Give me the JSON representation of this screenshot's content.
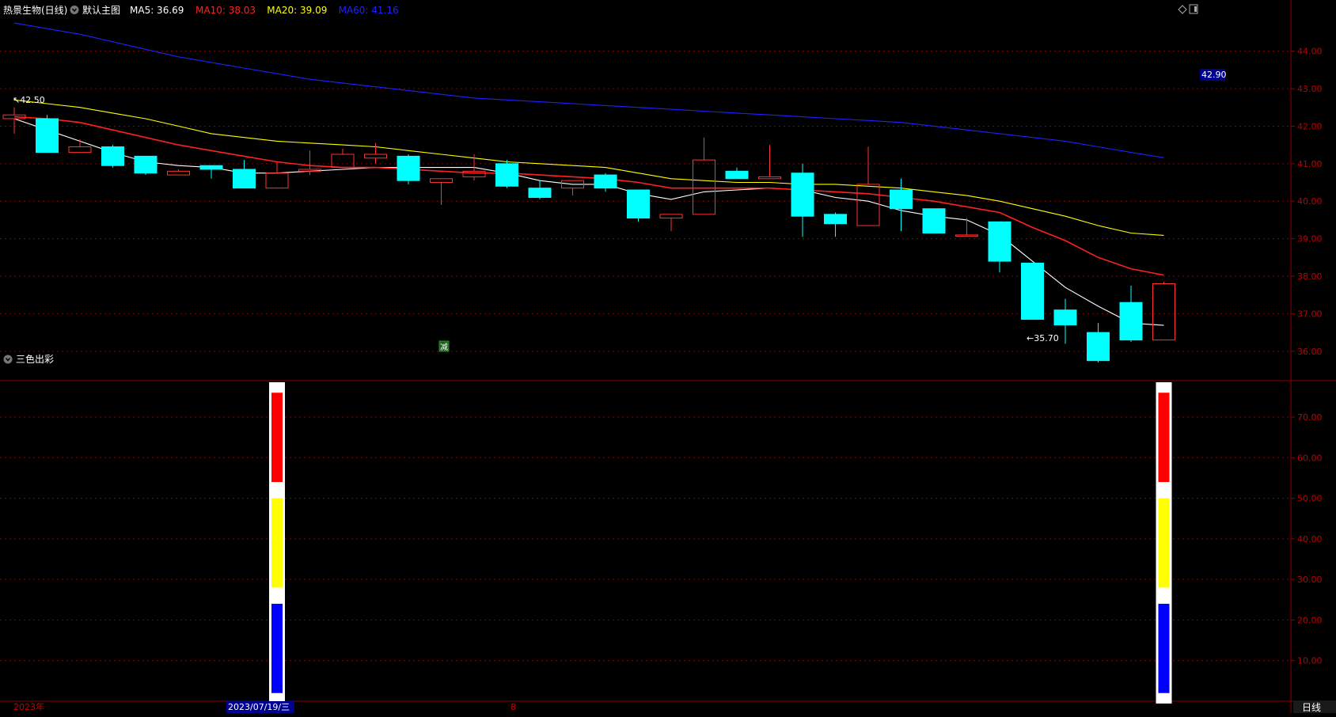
{
  "header": {
    "stock_name": "热景生物(日线)",
    "template_label": "默认主图",
    "ma_items": [
      {
        "label": "MA5: 36.69",
        "color": "#ffffff"
      },
      {
        "label": "MA10: 38.03",
        "color": "#ff2020"
      },
      {
        "label": "MA20: 39.09",
        "color": "#ffff00"
      },
      {
        "label": "MA60: 41.16",
        "color": "#2020ff"
      }
    ]
  },
  "sub_panel": {
    "title": "三色出彩"
  },
  "footer": {
    "year_label": "2023年",
    "date_label": "2023/07/19/三",
    "marker_label": "8",
    "period_label": "日线"
  },
  "annotations": {
    "high_label": "42.50",
    "low_label": "35.70",
    "price_tag": "42.90",
    "event_badge": "减"
  },
  "colors": {
    "up": "#ff3232",
    "down": "#00ffff",
    "grid": "#8b0000",
    "axis_text": "#c00000"
  },
  "chart_data": [
    {
      "type": "candlestick",
      "title": "热景生物(日线)",
      "y_ticks": [
        "36.00",
        "37.00",
        "38.00",
        "39.00",
        "40.00",
        "41.00",
        "42.00",
        "43.00",
        "44.00"
      ],
      "ylim": [
        35.3,
        44.9
      ],
      "candles": [
        {
          "o": 42.2,
          "h": 42.5,
          "l": 41.8,
          "c": 42.3
        },
        {
          "o": 42.2,
          "h": 42.3,
          "l": 41.3,
          "c": 41.3
        },
        {
          "o": 41.3,
          "h": 41.65,
          "l": 41.3,
          "c": 41.45
        },
        {
          "o": 41.45,
          "h": 41.5,
          "l": 40.9,
          "c": 40.95
        },
        {
          "o": 41.2,
          "h": 41.2,
          "l": 40.7,
          "c": 40.75
        },
        {
          "o": 40.7,
          "h": 40.85,
          "l": 40.7,
          "c": 40.8
        },
        {
          "o": 40.95,
          "h": 40.95,
          "l": 40.6,
          "c": 40.85
        },
        {
          "o": 40.85,
          "h": 41.1,
          "l": 40.35,
          "c": 40.35
        },
        {
          "o": 40.35,
          "h": 41.05,
          "l": 40.35,
          "c": 40.75
        },
        {
          "o": 40.8,
          "h": 41.35,
          "l": 40.7,
          "c": 40.85
        },
        {
          "o": 40.9,
          "h": 41.4,
          "l": 40.9,
          "c": 41.25
        },
        {
          "o": 41.15,
          "h": 41.55,
          "l": 41.0,
          "c": 41.25
        },
        {
          "o": 41.2,
          "h": 41.25,
          "l": 40.45,
          "c": 40.55
        },
        {
          "o": 40.5,
          "h": 40.6,
          "l": 39.9,
          "c": 40.6
        },
        {
          "o": 40.65,
          "h": 41.25,
          "l": 40.55,
          "c": 40.8
        },
        {
          "o": 41.0,
          "h": 41.1,
          "l": 40.35,
          "c": 40.4
        },
        {
          "o": 40.35,
          "h": 40.55,
          "l": 40.05,
          "c": 40.1
        },
        {
          "o": 40.35,
          "h": 40.55,
          "l": 40.15,
          "c": 40.55
        },
        {
          "o": 40.7,
          "h": 40.75,
          "l": 40.25,
          "c": 40.35
        },
        {
          "o": 40.3,
          "h": 40.3,
          "l": 39.45,
          "c": 39.55
        },
        {
          "o": 39.55,
          "h": 39.65,
          "l": 39.2,
          "c": 39.65
        },
        {
          "o": 39.65,
          "h": 41.7,
          "l": 39.65,
          "c": 41.1
        },
        {
          "o": 40.8,
          "h": 40.9,
          "l": 40.6,
          "c": 40.6
        },
        {
          "o": 40.6,
          "h": 41.5,
          "l": 40.6,
          "c": 40.65
        },
        {
          "o": 40.75,
          "h": 41.0,
          "l": 39.05,
          "c": 39.6
        },
        {
          "o": 39.65,
          "h": 39.7,
          "l": 39.05,
          "c": 39.4
        },
        {
          "o": 39.35,
          "h": 41.45,
          "l": 39.35,
          "c": 40.45
        },
        {
          "o": 40.3,
          "h": 40.6,
          "l": 39.2,
          "c": 39.8
        },
        {
          "o": 39.8,
          "h": 39.8,
          "l": 39.15,
          "c": 39.15
        },
        {
          "o": 39.1,
          "h": 39.55,
          "l": 39.1,
          "c": 39.1
        },
        {
          "o": 39.45,
          "h": 39.45,
          "l": 38.1,
          "c": 38.4
        },
        {
          "o": 38.35,
          "h": 38.35,
          "l": 36.85,
          "c": 36.85
        },
        {
          "o": 37.1,
          "h": 37.4,
          "l": 36.2,
          "c": 36.7
        },
        {
          "o": 36.5,
          "h": 36.75,
          "l": 35.7,
          "c": 35.75
        },
        {
          "o": 37.3,
          "h": 37.75,
          "l": 36.25,
          "c": 36.3
        },
        {
          "o": 36.3,
          "h": 37.85,
          "l": 36.3,
          "c": 37.8
        }
      ],
      "series": [
        {
          "name": "MA5",
          "color": "#ffffff",
          "values": [
            42.2,
            41.9,
            41.6,
            41.3,
            41.05,
            40.95,
            40.9,
            40.75,
            40.75,
            40.8,
            40.85,
            40.9,
            40.9,
            40.9,
            40.9,
            40.75,
            40.55,
            40.45,
            40.45,
            40.2,
            40.05,
            40.25,
            40.3,
            40.35,
            40.3,
            40.1,
            40.0,
            39.75,
            39.6,
            39.5,
            39.1,
            38.4,
            37.7,
            37.2,
            36.75,
            36.69
          ]
        },
        {
          "name": "MA10",
          "color": "#ff2020",
          "values": [
            42.25,
            42.2,
            42.1,
            41.9,
            41.7,
            41.5,
            41.35,
            41.2,
            41.05,
            40.95,
            40.9,
            40.9,
            40.85,
            40.8,
            40.75,
            40.75,
            40.7,
            40.65,
            40.6,
            40.5,
            40.35,
            40.35,
            40.35,
            40.35,
            40.3,
            40.25,
            40.2,
            40.1,
            40.0,
            39.85,
            39.7,
            39.3,
            38.95,
            38.5,
            38.2,
            38.03
          ]
        },
        {
          "name": "MA20",
          "color": "#ffff00",
          "values": [
            42.7,
            42.6,
            42.5,
            42.35,
            42.2,
            42.0,
            41.8,
            41.7,
            41.6,
            41.55,
            41.5,
            41.45,
            41.35,
            41.25,
            41.15,
            41.05,
            41.0,
            40.95,
            40.9,
            40.75,
            40.6,
            40.55,
            40.5,
            40.5,
            40.45,
            40.45,
            40.4,
            40.35,
            40.25,
            40.15,
            40.0,
            39.8,
            39.6,
            39.35,
            39.15,
            39.09
          ]
        },
        {
          "name": "MA60",
          "color": "#2020ff",
          "values": [
            44.75,
            44.6,
            44.45,
            44.25,
            44.05,
            43.85,
            43.7,
            43.55,
            43.4,
            43.25,
            43.15,
            43.05,
            42.95,
            42.85,
            42.75,
            42.7,
            42.65,
            42.6,
            42.55,
            42.5,
            42.45,
            42.4,
            42.35,
            42.3,
            42.25,
            42.2,
            42.15,
            42.1,
            42.0,
            41.9,
            41.8,
            41.7,
            41.6,
            41.45,
            41.3,
            41.16
          ]
        }
      ]
    },
    {
      "type": "bar",
      "title": "三色出彩",
      "y_ticks": [
        "10.00",
        "20.00",
        "30.00",
        "40.00",
        "50.00",
        "60.00",
        "70.00"
      ],
      "ylim": [
        0,
        78
      ],
      "bars": [
        {
          "index": 8,
          "segments": [
            {
              "from": 2,
              "to": 24,
              "color": "#0000ff"
            },
            {
              "from": 28,
              "to": 50,
              "color": "#ffff00"
            },
            {
              "from": 54,
              "to": 76,
              "color": "#ff0000"
            }
          ]
        },
        {
          "index": 35,
          "segments": [
            {
              "from": 2,
              "to": 24,
              "color": "#0000ff"
            },
            {
              "from": 28,
              "to": 50,
              "color": "#ffff00"
            },
            {
              "from": 54,
              "to": 76,
              "color": "#ff0000"
            }
          ]
        }
      ]
    }
  ]
}
